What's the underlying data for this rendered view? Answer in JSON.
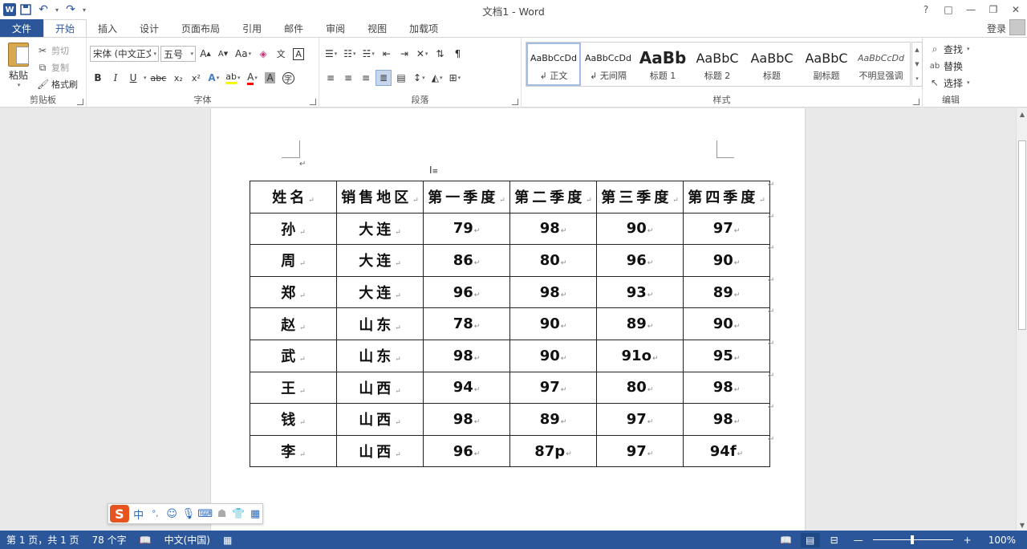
{
  "window": {
    "title": "文档1 - Word",
    "controls": [
      "?",
      "□",
      "—",
      "❐",
      "✕"
    ]
  },
  "tabs": {
    "file": "文件",
    "items": [
      "开始",
      "插入",
      "设计",
      "页面布局",
      "引用",
      "邮件",
      "审阅",
      "视图",
      "加载项"
    ],
    "login": "登录"
  },
  "clipboard": {
    "paste": "粘贴",
    "cut": "剪切",
    "copy": "复制",
    "format_painter": "格式刷",
    "label": "剪贴板"
  },
  "font": {
    "name": "宋体 (中文正文",
    "size": "五号",
    "label": "字体",
    "grow": "A",
    "shrink": "A",
    "case": "Aa",
    "bold": "B",
    "italic": "I",
    "underline": "U",
    "strike": "abc",
    "sub": "x₂",
    "sup": "x²"
  },
  "paragraph": {
    "label": "段落"
  },
  "styles": {
    "label": "样式",
    "items": [
      {
        "sample": "AaBbCcDd",
        "name": "↲ 正文"
      },
      {
        "sample": "AaBbCcDd",
        "name": "↲ 无间隔"
      },
      {
        "sample": "AaBb",
        "name": "标题 1"
      },
      {
        "sample": "AaBbC",
        "name": "标题 2"
      },
      {
        "sample": "AaBbC",
        "name": "标题"
      },
      {
        "sample": "AaBbC",
        "name": "副标题"
      },
      {
        "sample": "AaBbCcDd",
        "name": "不明显强调"
      }
    ]
  },
  "editing": {
    "label": "编辑",
    "find": "查找",
    "replace": "替换",
    "select": "选择"
  },
  "table": {
    "headers": [
      "姓名",
      "销售地区",
      "第一季度",
      "第二季度",
      "第三季度",
      "第四季度"
    ],
    "rows": [
      [
        "孙",
        "大连",
        "79",
        "98",
        "90",
        "97"
      ],
      [
        "周",
        "大连",
        "86",
        "80",
        "96",
        "90"
      ],
      [
        "郑",
        "大连",
        "96",
        "98",
        "93",
        "89"
      ],
      [
        "赵",
        "山东",
        "78",
        "90",
        "89",
        "90"
      ],
      [
        "武",
        "山东",
        "98",
        "90",
        "91o",
        "95"
      ],
      [
        "王",
        "山西",
        "94",
        "97",
        "80",
        "98"
      ],
      [
        "钱",
        "山西",
        "98",
        "89",
        "97",
        "98"
      ],
      [
        "李",
        "山西",
        "96",
        "87p",
        "97",
        "94f"
      ]
    ]
  },
  "ime": {
    "logo": "S",
    "mode": "中",
    "punct": "°,"
  },
  "status": {
    "page": "第 1 页，共 1 页",
    "words": "78 个字",
    "language": "中文(中国)",
    "zoom": "100%",
    "zoom_minus": "—",
    "zoom_plus": "+"
  },
  "colors": {
    "accent": "#2b579a",
    "highlight": "#ffff00",
    "font_color": "#ff0000"
  }
}
